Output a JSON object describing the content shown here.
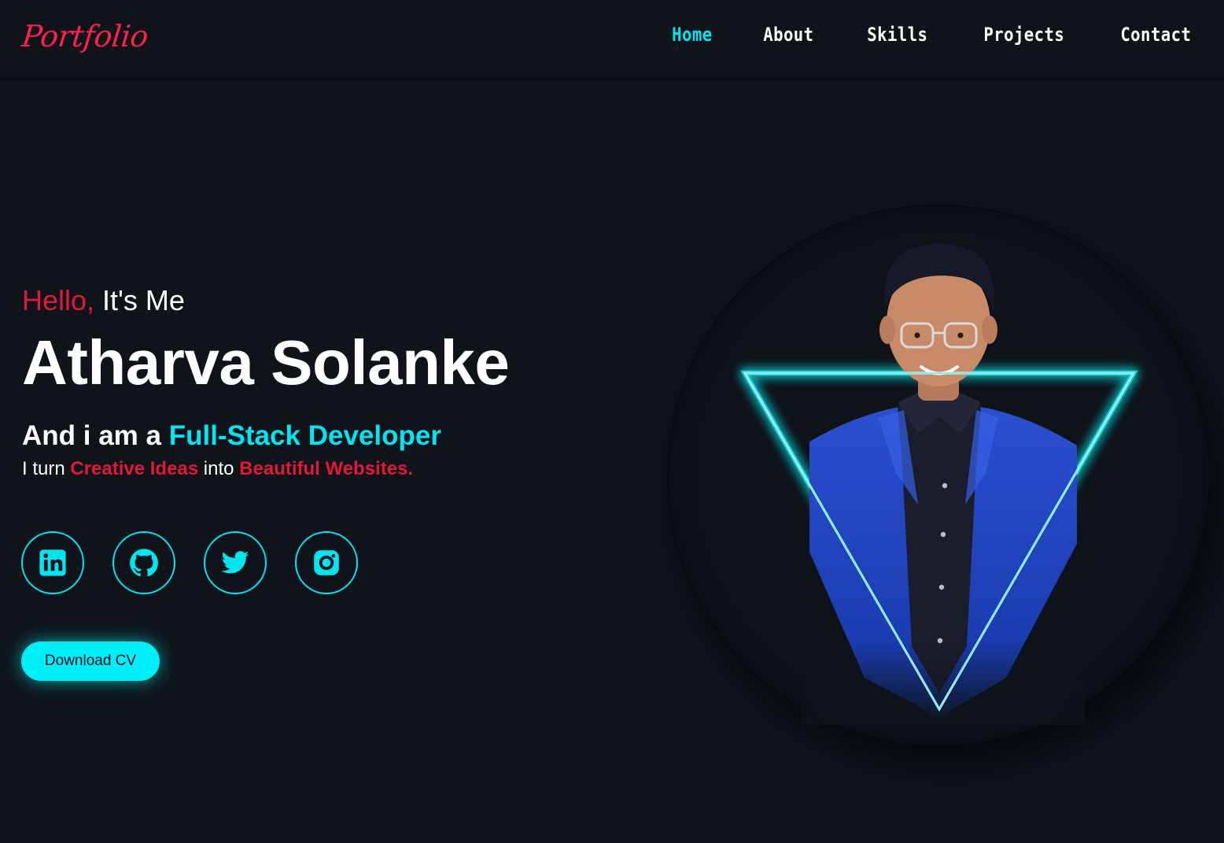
{
  "nav": {
    "logo": "Portfolio",
    "links": [
      "Home",
      "About",
      "Skills",
      "Projects",
      "Contact"
    ],
    "active": "Home"
  },
  "hero": {
    "greeting_highlight": "Hello,",
    "greeting_rest": " It's Me",
    "name": "Atharva Solanke",
    "role_prefix": "And i am a ",
    "role": "Full-Stack Developer",
    "tagline_1": "I turn ",
    "tagline_highlight_1": "Creative Ideas",
    "tagline_2": " into ",
    "tagline_highlight_2": "Beautiful Websites."
  },
  "socials": [
    {
      "name": "linkedin-icon"
    },
    {
      "name": "github-icon"
    },
    {
      "name": "twitter-icon"
    },
    {
      "name": "instagram-icon"
    }
  ],
  "cv_button": "Download CV",
  "colors": {
    "background": "#0f141b",
    "accent_cyan": "#00e5f0",
    "accent_red": "#e21839",
    "logo_pink": "#ff1f4e"
  }
}
